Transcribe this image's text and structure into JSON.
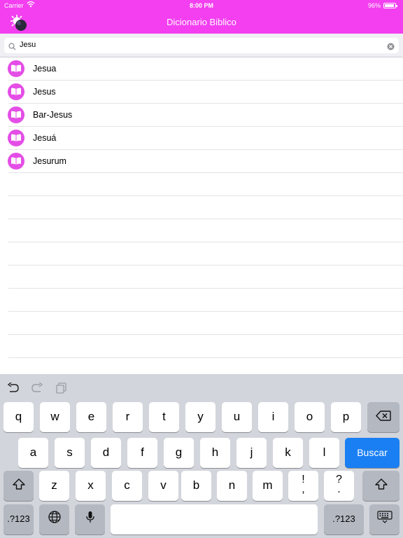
{
  "status_bar": {
    "carrier": "Carrier",
    "time": "8:00 PM",
    "battery": "96%"
  },
  "nav": {
    "title": "Dicionario Biblico"
  },
  "search": {
    "value": "Jesu"
  },
  "results": [
    {
      "label": "Jesua"
    },
    {
      "label": "Jesus"
    },
    {
      "label": "Bar-Jesus"
    },
    {
      "label": "Jesuá"
    },
    {
      "label": "Jesurum"
    }
  ],
  "keyboard": {
    "row1": [
      "q",
      "w",
      "e",
      "r",
      "t",
      "y",
      "u",
      "i",
      "o",
      "p"
    ],
    "row2": [
      "a",
      "s",
      "d",
      "f",
      "g",
      "h",
      "j",
      "k",
      "l"
    ],
    "row3": [
      "z",
      "x",
      "c",
      "v",
      "b",
      "n",
      "m"
    ],
    "punct1_top": "!",
    "punct1_bottom": ",",
    "punct2_top": "?",
    "punct2_bottom": ".",
    "search_key": "Buscar",
    "numbers_key": ".?123"
  },
  "icons": {
    "nav": "sun-moon-icon",
    "result": "open-book-icon",
    "search": "magnifier-icon",
    "clear": "clear-circle-icon"
  },
  "colors": {
    "brand": "#f33ff0",
    "badge": "#e44ee6",
    "search_key": "#1a7ff3"
  }
}
